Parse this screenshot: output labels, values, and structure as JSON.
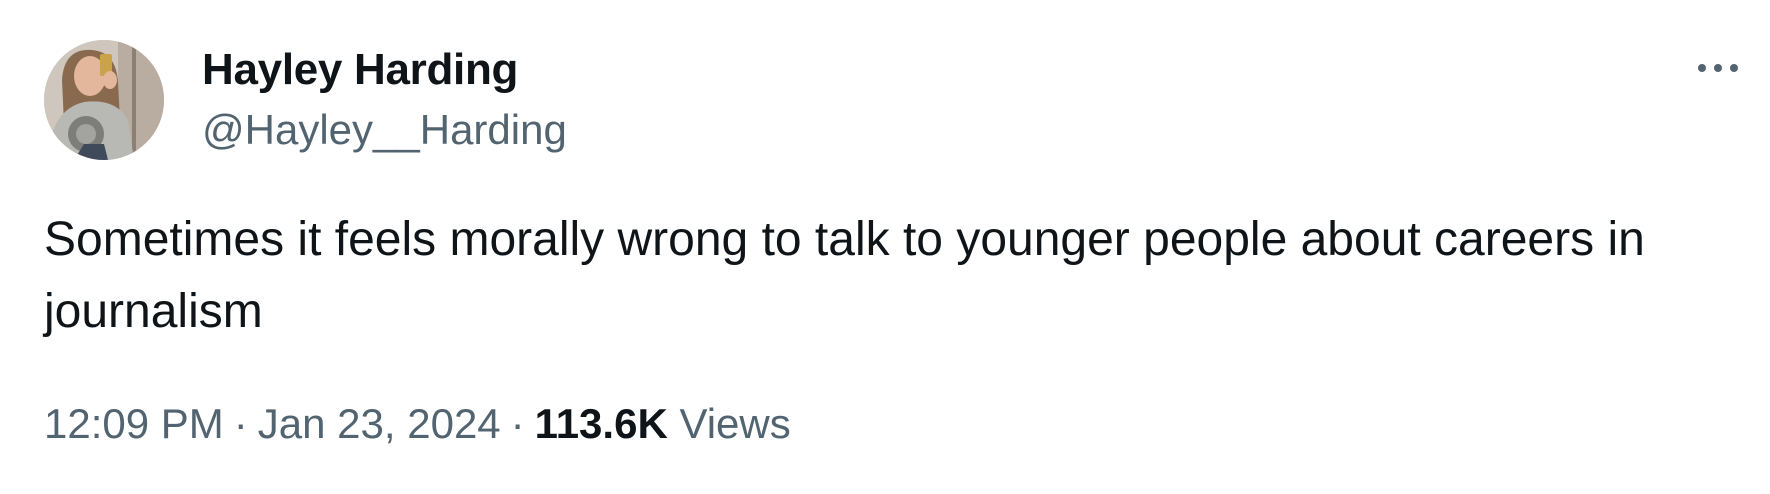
{
  "author": {
    "display_name": "Hayley Harding",
    "handle": "@Hayley__Harding",
    "avatar_icon": "profile-photo"
  },
  "more_icon": "ellipsis-icon",
  "tweet": {
    "text": "Sometimes it feels morally wrong to talk to younger people about careers in journalism"
  },
  "meta": {
    "time": "12:09 PM",
    "separator": "·",
    "date": "Jan 23, 2024",
    "views_count": "113.6K",
    "views_label": "Views"
  },
  "colors": {
    "primary_text": "#0f1419",
    "secondary_text": "#536471",
    "background": "#ffffff"
  }
}
